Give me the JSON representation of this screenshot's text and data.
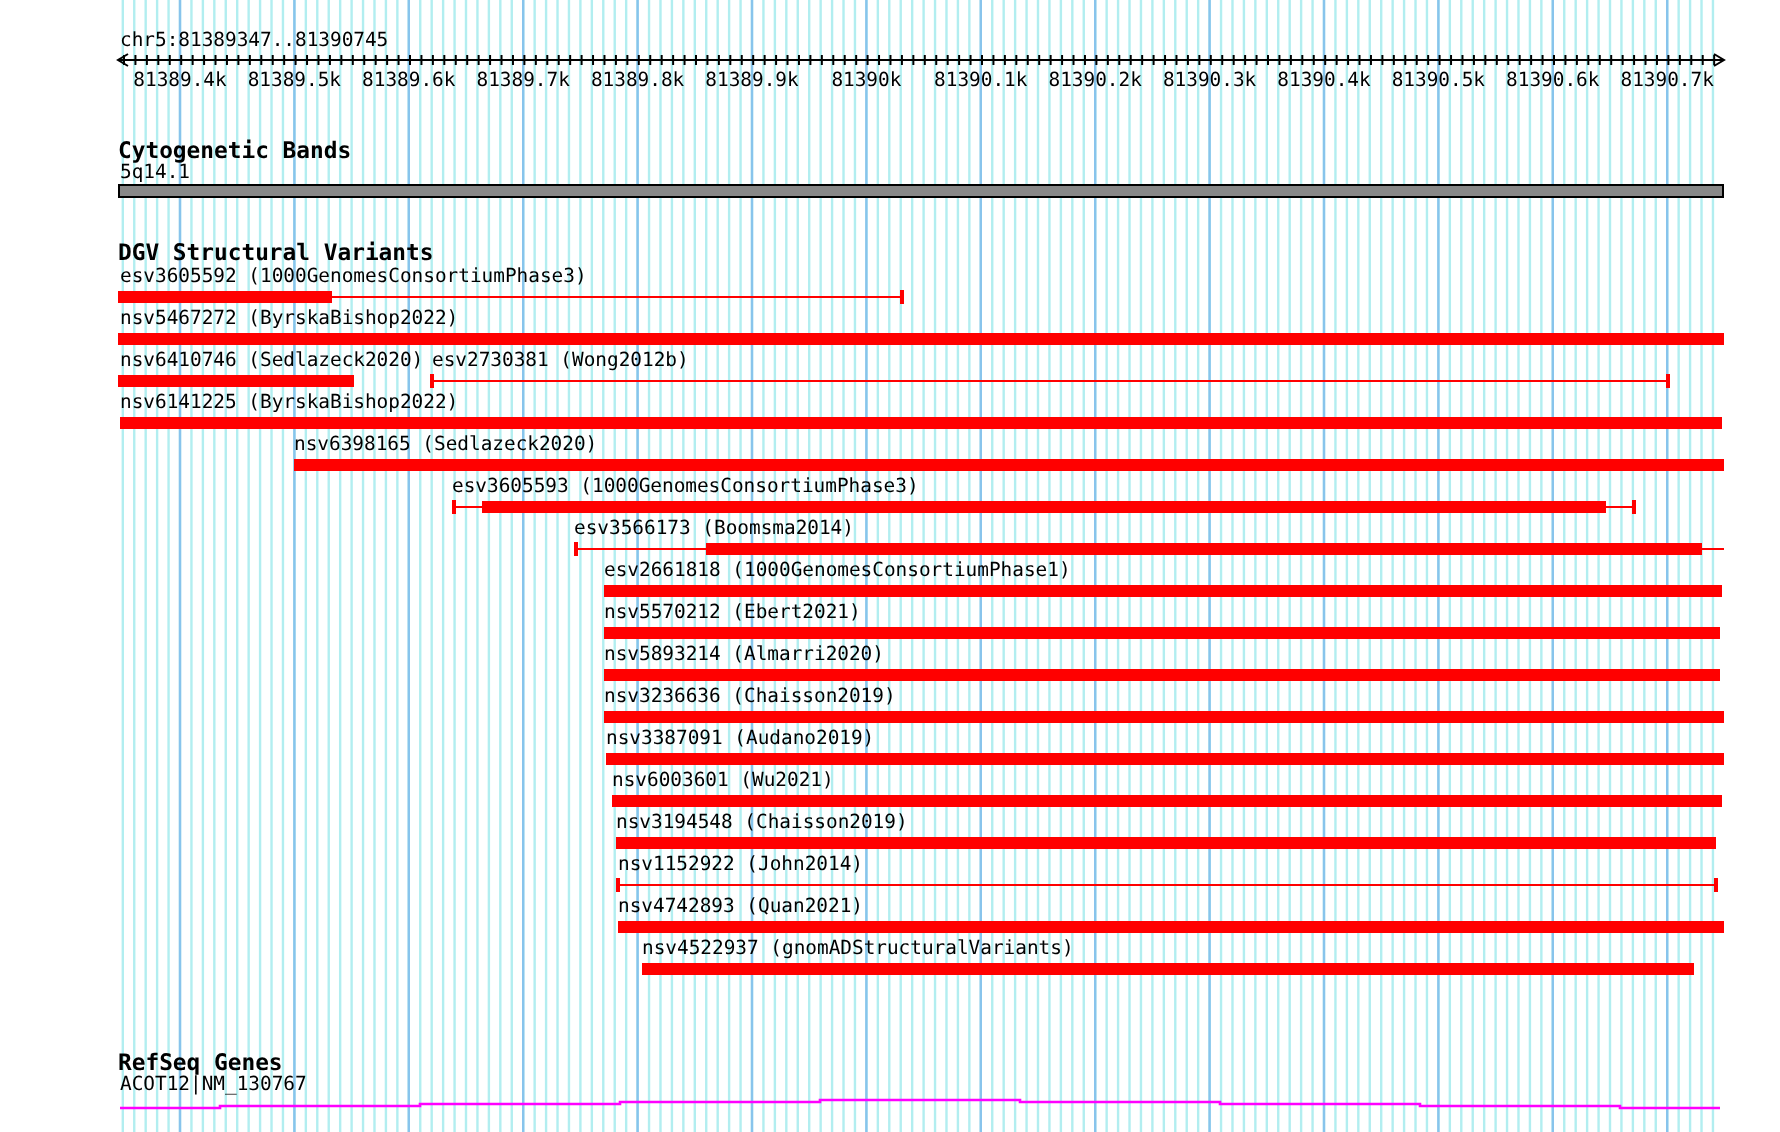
{
  "location": "chr5:81389347..81390745",
  "ruler": {
    "ticks": [
      "81389.4k",
      "81389.5k",
      "81389.6k",
      "81389.7k",
      "81389.8k",
      "81389.9k",
      "81390k",
      "81390.1k",
      "81390.2k",
      "81390.3k",
      "81390.4k",
      "81390.5k",
      "81390.6k",
      "81390.7k"
    ]
  },
  "tracks": [
    {
      "kind": "bands",
      "title": "Cytogenetic Bands",
      "band": "5q14.1"
    },
    {
      "kind": "variants",
      "title": "DGV Structural Variants",
      "rows": [
        {
          "features": [
            {
              "label": "esv3605592 (1000GenomesConsortiumPhase3)"
            }
          ]
        },
        {
          "features": [
            {
              "label": "nsv5467272 (ByrskaBishop2022)"
            }
          ]
        },
        {
          "features": [
            {
              "label": "nsv6410746 (Sedlazeck2020)"
            },
            {
              "label": "esv2730381 (Wong2012b)"
            }
          ]
        },
        {
          "features": [
            {
              "label": "nsv6141225 (ByrskaBishop2022)"
            }
          ]
        },
        {
          "features": [
            {
              "label": "nsv6398165 (Sedlazeck2020)"
            }
          ]
        },
        {
          "features": [
            {
              "label": "esv3605593 (1000GenomesConsortiumPhase3)"
            }
          ]
        },
        {
          "features": [
            {
              "label": "esv3566173 (Boomsma2014)"
            }
          ]
        },
        {
          "features": [
            {
              "label": "esv2661818 (1000GenomesConsortiumPhase1)"
            }
          ]
        },
        {
          "features": [
            {
              "label": "nsv5570212 (Ebert2021)"
            }
          ]
        },
        {
          "features": [
            {
              "label": "nsv5893214 (Almarri2020)"
            }
          ]
        },
        {
          "features": [
            {
              "label": "nsv3236636 (Chaisson2019)"
            }
          ]
        },
        {
          "features": [
            {
              "label": "nsv3387091 (Audano2019)"
            }
          ]
        },
        {
          "features": [
            {
              "label": "nsv6003601 (Wu2021)"
            }
          ]
        },
        {
          "features": [
            {
              "label": "nsv3194548 (Chaisson2019)"
            }
          ]
        },
        {
          "features": [
            {
              "label": "nsv1152922 (John2014)"
            }
          ]
        },
        {
          "features": [
            {
              "label": "nsv4742893 (Quan2021)"
            }
          ]
        },
        {
          "features": [
            {
              "label": "nsv4522937 (gnomADStructuralVariants)"
            }
          ]
        }
      ]
    },
    {
      "kind": "genes",
      "title": "RefSeq Genes",
      "gene": "ACOT12|NM_130767"
    }
  ]
}
